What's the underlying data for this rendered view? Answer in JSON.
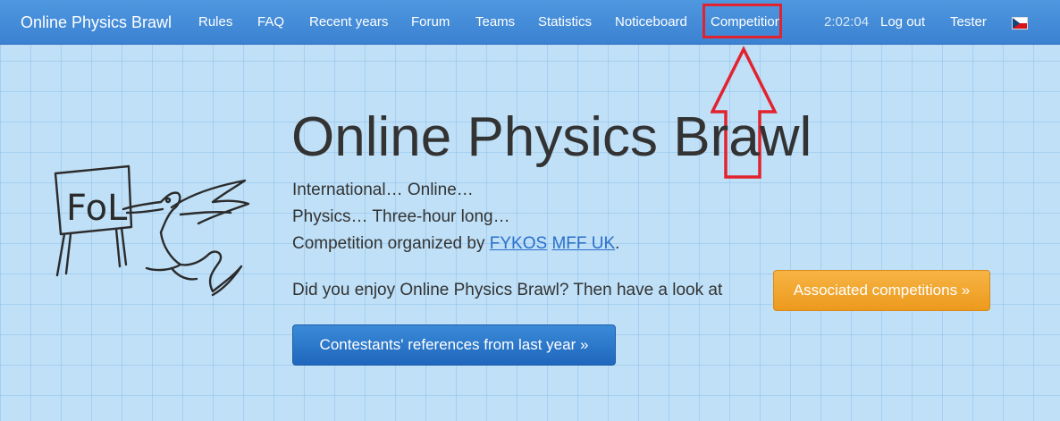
{
  "nav": {
    "brand": "Online Physics Brawl",
    "items": [
      {
        "label": "Rules"
      },
      {
        "label": "FAQ"
      },
      {
        "label": "Recent years"
      },
      {
        "label": "Forum"
      },
      {
        "label": "Teams"
      },
      {
        "label": "Statistics"
      },
      {
        "label": "Noticeboard"
      },
      {
        "label": "Competition"
      }
    ],
    "clock": "2:02:04",
    "logout": "Log out",
    "user": "Tester",
    "flag_icon": "czech-flag-icon"
  },
  "annotation": {
    "color": "#e2222e",
    "highlighted_item": "Competition",
    "icon": "up-arrow-icon"
  },
  "logo": {
    "sign_text": "FoL",
    "icon": "fol-mascot-logo"
  },
  "hero": {
    "title": "Online Physics Brawl",
    "line1": "International… Online…",
    "line2": "Physics… Three-hour long…",
    "line3_prefix": "Competition organized by ",
    "link_fykos": "FYKOS",
    "link_mff": "MFF UK",
    "line3_suffix": ".",
    "enjoy_text": "Did you enjoy Online Physics Brawl? Then have a look at",
    "associated_button": "Associated competitions »",
    "references_button": "Contestants' references from last year »"
  },
  "colors": {
    "navbar": "#3b82d2",
    "background": "#bfe0f7",
    "button_orange": "#ec9a1d",
    "button_blue": "#2067bd",
    "link": "#2a6fc9"
  }
}
